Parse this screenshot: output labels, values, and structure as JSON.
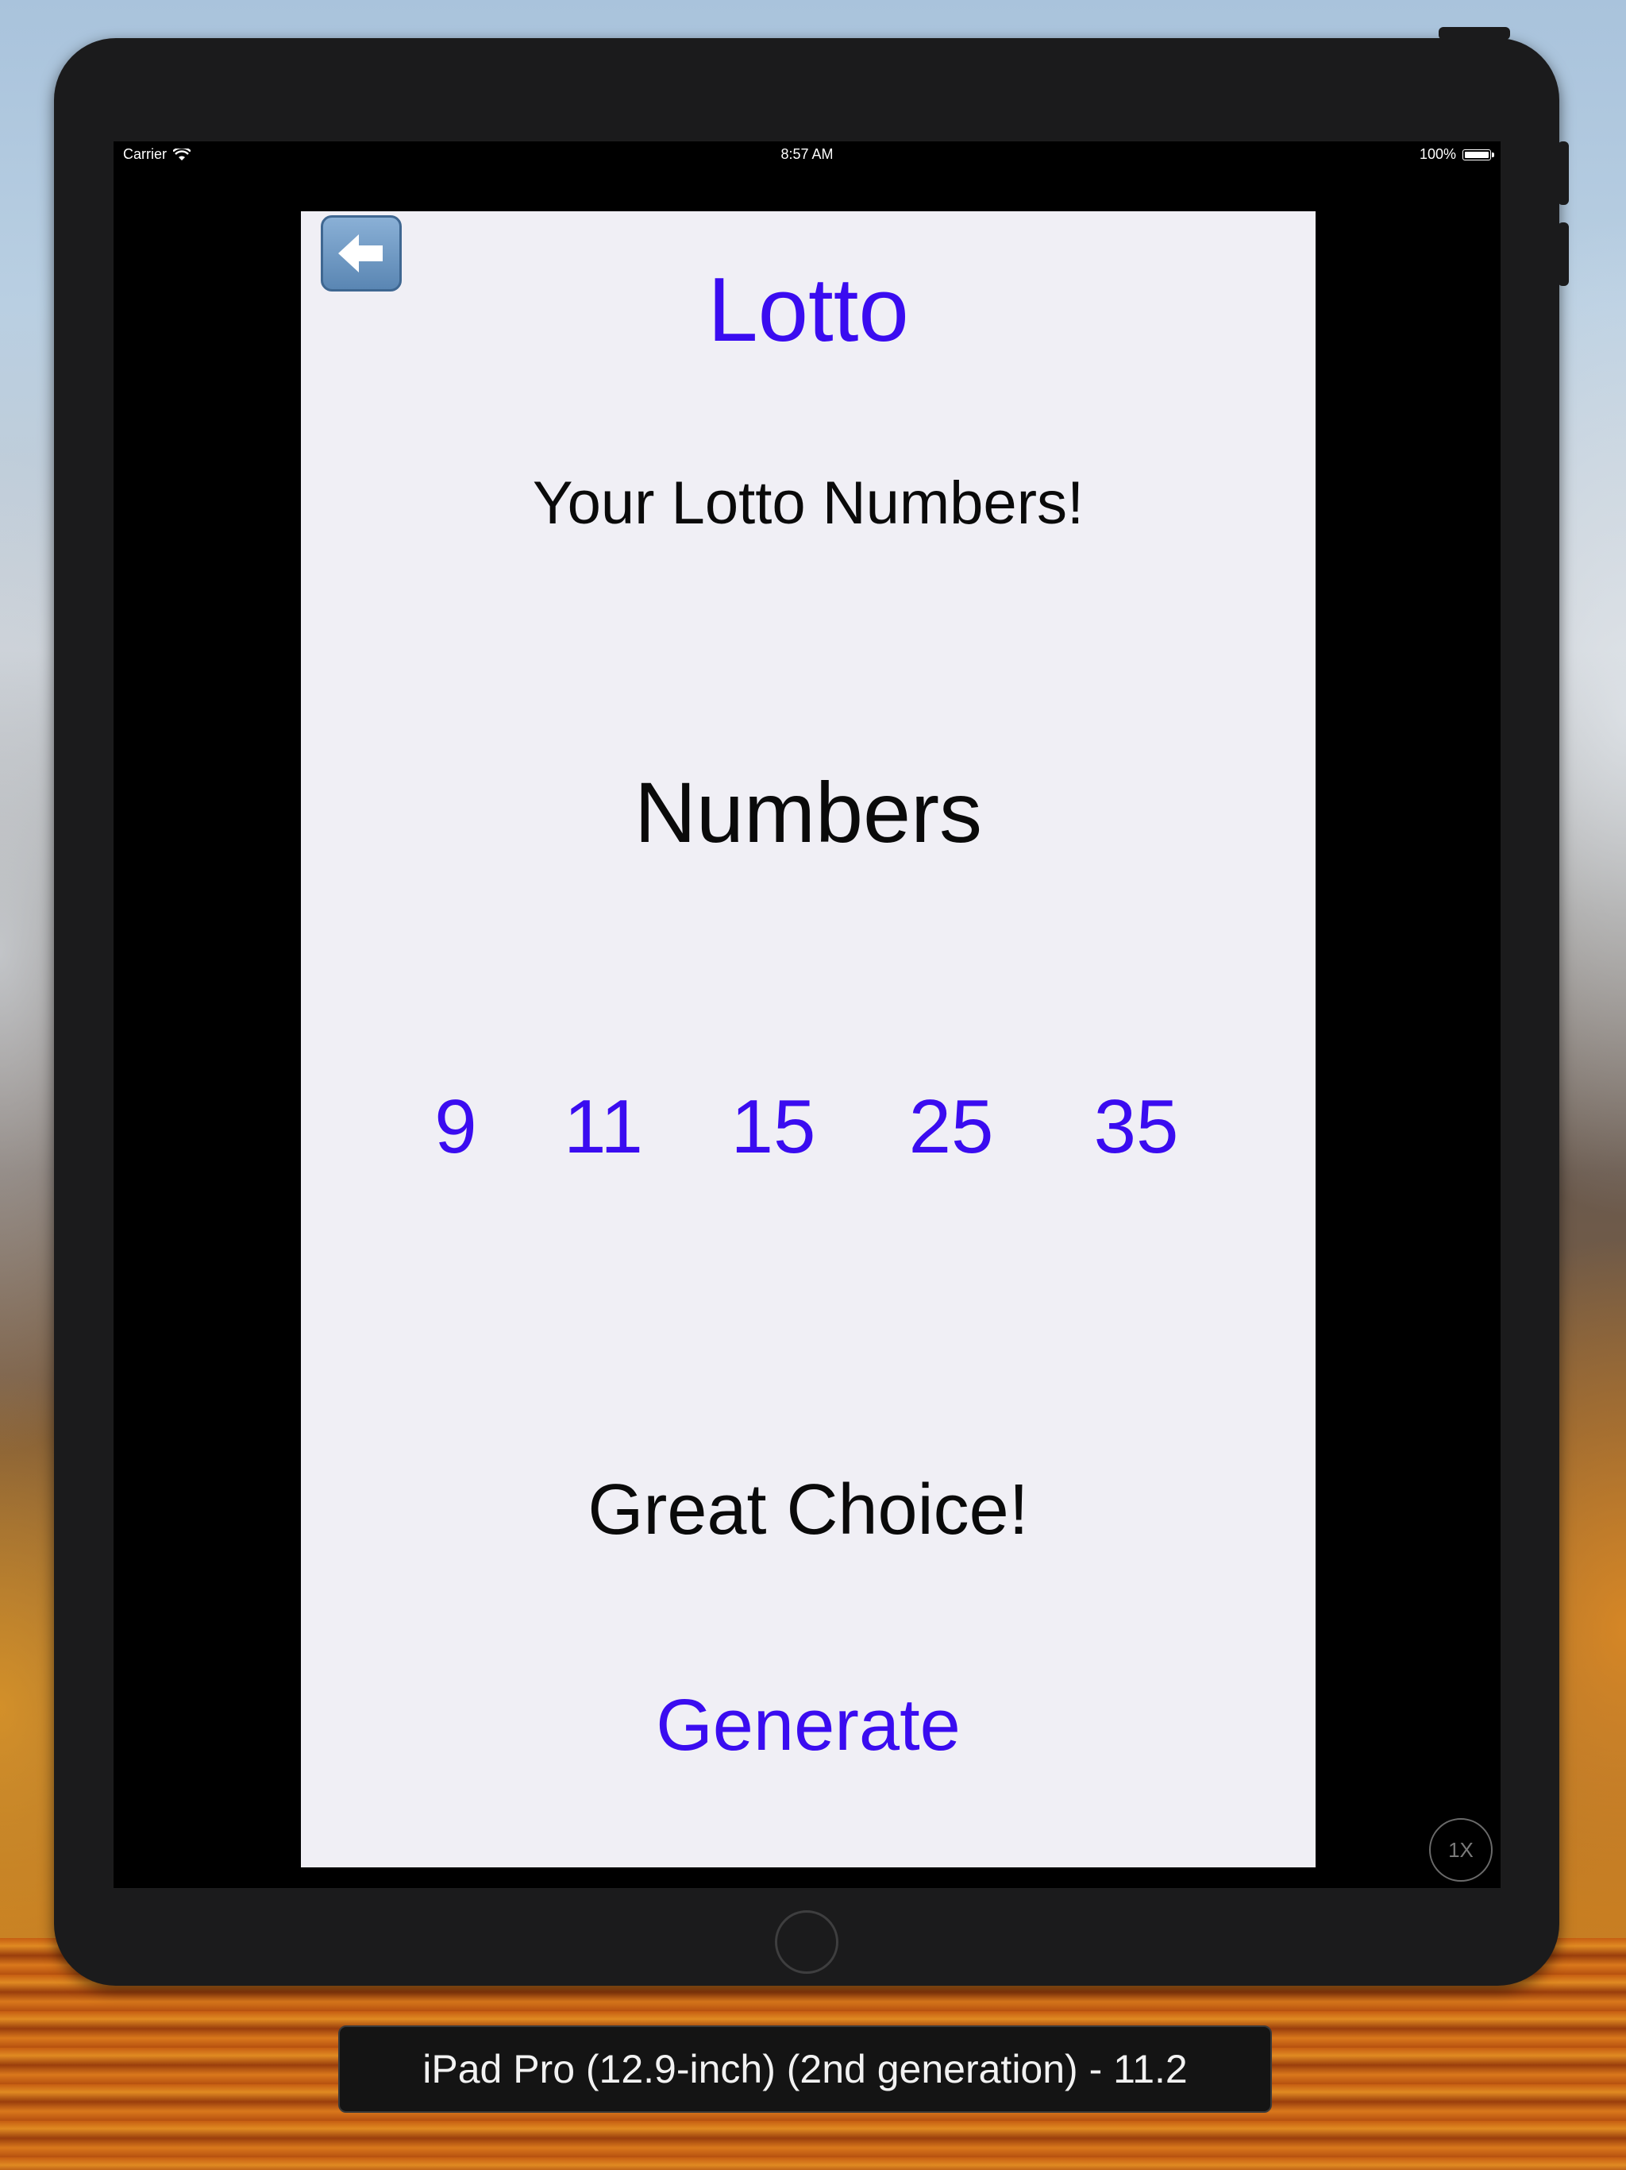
{
  "simulator": {
    "device_label": "iPad Pro (12.9-inch) (2nd generation) - 11.2",
    "zoom_badge": "1X"
  },
  "status_bar": {
    "carrier": "Carrier",
    "time": "8:57 AM",
    "battery": "100%"
  },
  "app": {
    "back_icon": "back-arrow-icon",
    "title": "Lotto",
    "subtitle": "Your Lotto Numbers!",
    "numbers_heading": "Numbers",
    "numbers": [
      "9",
      "11",
      "15",
      "25",
      "35"
    ],
    "message": "Great Choice!",
    "generate_label": "Generate"
  },
  "colors": {
    "accent": "#3a0cf0",
    "app_background": "#f0eff5",
    "text": "#0a0a0a"
  }
}
